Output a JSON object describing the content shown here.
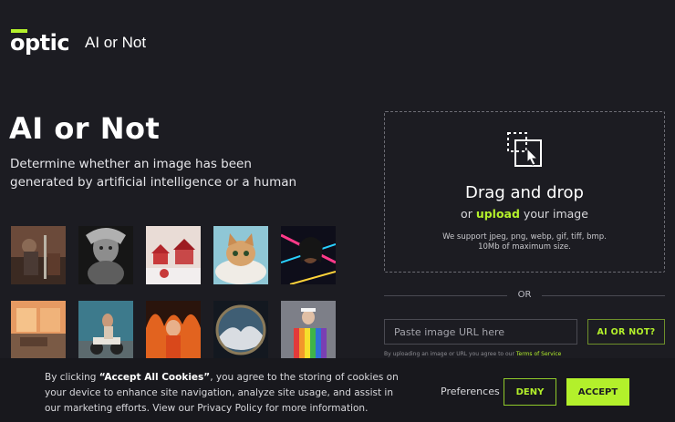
{
  "header": {
    "logo_text": "optic",
    "product_name": "AI or Not"
  },
  "hero": {
    "title": "AI or Not",
    "description": "Determine whether an image has been generated by artificial intelligence or a human"
  },
  "samples": [
    {
      "name": "sample-image-armored-warrior"
    },
    {
      "name": "sample-image-alien-bust"
    },
    {
      "name": "sample-image-red-village"
    },
    {
      "name": "sample-image-cat-in-clouds"
    },
    {
      "name": "sample-image-neon-portrait"
    },
    {
      "name": "sample-image-sunset-room"
    },
    {
      "name": "sample-image-scooter-rider"
    },
    {
      "name": "sample-image-child-fire"
    },
    {
      "name": "sample-image-round-landscape"
    },
    {
      "name": "sample-image-pope-rainbow"
    }
  ],
  "upload": {
    "title": "Drag and drop",
    "or_word": "or",
    "upload_word": "upload",
    "suffix": "your image",
    "formats": "We support jpeg, png, webp, gif, tiff, bmp.",
    "size_limit": "10Mb of maximum size.",
    "icon": "drag-drop-icon"
  },
  "divider": {
    "or": "OR"
  },
  "url_form": {
    "placeholder": "Paste image URL here",
    "button_label": "AI OR NOT?",
    "terms_prefix": "By uploading an image or URL you agree to our",
    "terms_link": "Terms of Service"
  },
  "cookie_banner": {
    "prefix": "By clicking",
    "bold": "“Accept All Cookies”",
    "rest": ", you agree to the storing of cookies on your device to enhance site navigation, analyze site usage, and assist in our marketing efforts. View our Privacy Policy for more information.",
    "preferences": "Preferences",
    "deny": "DENY",
    "accept": "ACCEPT"
  },
  "colors": {
    "background": "#1c1c22",
    "accent": "#b3f02b",
    "banner": "#18181d"
  }
}
